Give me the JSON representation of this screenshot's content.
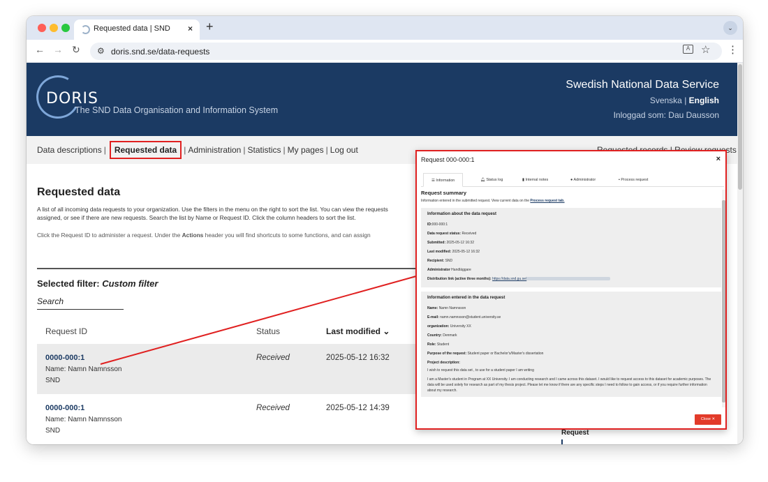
{
  "browser": {
    "tab_title": "Requested data | SND",
    "tab_close": "×",
    "new_tab": "+",
    "url": "doris.snd.se/data-requests"
  },
  "header": {
    "logo_name": "DORIS",
    "logo_subtitle": "The SND Data Organisation and Information System",
    "org_name": "Swedish National Data Service",
    "lang_sv": "Svenska",
    "lang_sep": " | ",
    "lang_en": "English",
    "logged_in": "Inloggad som: Dau Dausson"
  },
  "menu": {
    "items": [
      "Data descriptions",
      "Requested data",
      "Administration",
      "Statistics",
      "My pages",
      "Log out"
    ],
    "sep": "|",
    "right": "Requested records | Review requests"
  },
  "main": {
    "heading": "Requested data",
    "intro": "A list of all incoming data requests to your organization. Use the filters in the menu on the right to sort the list. You can view the requests assigned, or see if there are new requests. Search the list by Name or Request ID. Click the column headers to sort the list.",
    "intro2_pre": "Click the Request ID to administer a request. Under the ",
    "intro2_bold": "Actions",
    "intro2_post": " header you will find shortcuts to some functions, and can assign",
    "filter_label": "Selected filter: ",
    "filter_value": "Custom filter",
    "search_label": "Search",
    "columns": {
      "id": "Request ID",
      "status": "Status",
      "modified": "Last modified ⌄"
    },
    "rows": [
      {
        "id": "0000-000:1",
        "name": "Name: Namn Namnsson",
        "org": "SND",
        "status": "Received",
        "date": "2025-05-12 16:32"
      },
      {
        "id": "0000-000:1",
        "name": "Name: Namn Namnsson",
        "org": "SND",
        "status": "Received",
        "date": "2025-05-12 14:39"
      }
    ],
    "side_label": "Request"
  },
  "modal": {
    "title": "Request 000-000:1",
    "close": "×",
    "tabs": [
      "Information",
      "Status log",
      "Internal notes",
      "Administrator",
      "Process request"
    ],
    "tab_icons": [
      "list-icon",
      "bell-icon",
      "comment-icon",
      "user-icon",
      "clipboard-icon"
    ],
    "summary_heading": "Request summary",
    "summary_intro": "Information entered in the submitted request. View current data on the ",
    "summary_link": "Process request tab.",
    "about_heading": "Information about the data request",
    "about": [
      {
        "label": "ID:",
        "value": "000-000:1"
      },
      {
        "label": "Data request status:",
        "value": "Received"
      },
      {
        "label": "Submitted:",
        "value": "2025-05-12 16:32"
      },
      {
        "label": "Last modified:",
        "value": "2025-05-12 16:32"
      },
      {
        "label": "Recipient:",
        "value": "SND"
      },
      {
        "label": "Administrator",
        "value": "Handläggare"
      }
    ],
    "dist_label": "Distribution link (active three months):",
    "dist_link": "https://data.snd.gu.se/",
    "entered_heading": "Information entered in the data request",
    "entered": [
      {
        "label": "Name:",
        "value": "Namn Namnsson"
      },
      {
        "label": "E-mail:",
        "value": "namn.namnsson@student.university.se"
      },
      {
        "label": "organization:",
        "value": "University XX"
      },
      {
        "label": "Country:",
        "value": "Denmark"
      },
      {
        "label": "Role:",
        "value": "Student"
      },
      {
        "label": "Purpose of the request:",
        "value": "Student paper or Bachelor's/Master's dissertation"
      }
    ],
    "project_label": "Project description:",
    "project_value": "I wish to request this data set , to use for a student paper I am writing",
    "message": "I am a Master's student in Program at XX University. I am conducting research and I came across this dataset. I would like to request access to this dataset for academic purposes. The data will be used solely for research as part of my thesis project. Please let me know if there are any specific steps I need to follow to gain access, or if you require further information about my research.",
    "close_button": "Close ✕"
  },
  "colors": {
    "header_bg": "#1b3a63",
    "highlight": "#e02020",
    "close_button": "#e23b2a"
  }
}
